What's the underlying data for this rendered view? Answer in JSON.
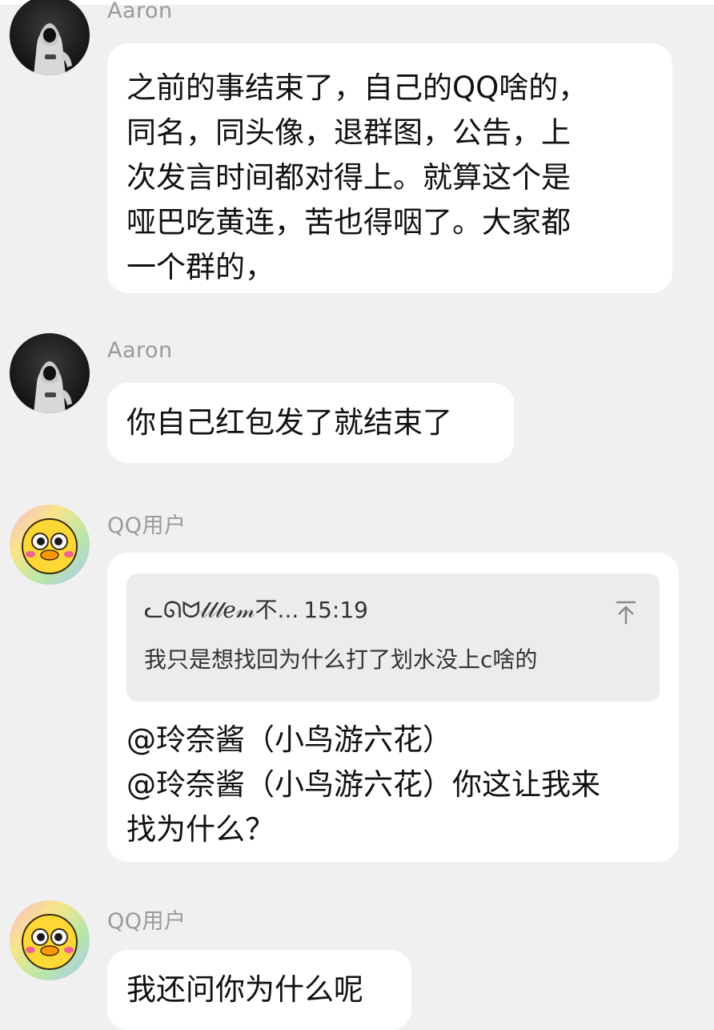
{
  "messages": [
    {
      "sender": "Aaron",
      "text": "之前的事结束了，自己的QQ啥的，\n同名，同头像，退群图，公告，上\n次发言时间都对得上。就算这个是\n哑巴吃黄连，苦也得咽了。大家都\n一个群的，"
    },
    {
      "sender": "Aaron",
      "text": "你自己红包发了就结束了"
    },
    {
      "sender": "QQ用户",
      "quote": {
        "author": "ᓚᘏᗢ𝓁𝓁𝓁ℯ𝓂不...",
        "time": "15:19",
        "text": "我只是想找回为什么打了划水没上c啥的"
      },
      "text": "@玲奈酱（小鸟游六花）\n @玲奈酱（小鸟游六花）你这让我来\n找为什么？"
    },
    {
      "sender": "QQ用户",
      "text": "我还问你为什么呢"
    }
  ]
}
